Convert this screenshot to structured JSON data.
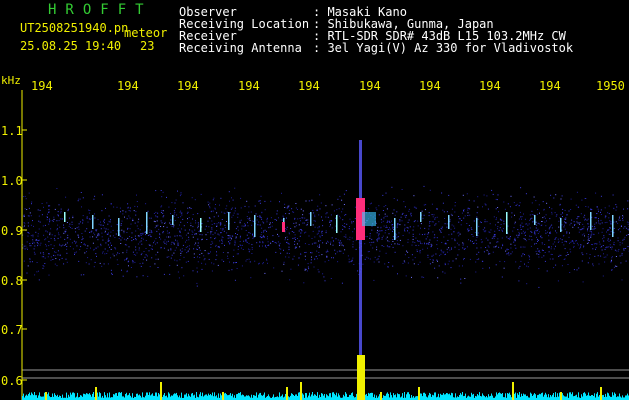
{
  "header": {
    "brand": "HROFFT",
    "filename": "UT2508251940.pn",
    "tag": "meteor",
    "datetime": "25.08.25 19:40",
    "count": "23"
  },
  "station": {
    "observer_label": "Observer",
    "observer_value": ": Masaki Kano",
    "location_label": "Receiving Location",
    "location_value": ": Shibukawa, Gunma, Japan",
    "receiver_label": "Receiver",
    "receiver_value": ": RTL-SDR SDR# 43dB L15 103.2MHz CW",
    "antenna_label": "Receiving Antenna",
    "antenna_value": ": 3el Yagi(V) Az 330 for Vladivostok"
  },
  "axis": {
    "y_unit": "kHz",
    "y_ticks": [
      "1.1",
      "1.0",
      "0.9",
      "0.8",
      "0.7",
      "0.6"
    ],
    "time_ticks": [
      "194",
      "194",
      "194",
      "194",
      "194",
      "194",
      "194",
      "194",
      "194",
      "1950"
    ]
  },
  "colors": {
    "noise": "#3a3adc",
    "streak": "#ff2d7a",
    "text_green": "#33cc33",
    "text_yellow": "#f0f000",
    "baseline": "#00e5ff"
  }
}
